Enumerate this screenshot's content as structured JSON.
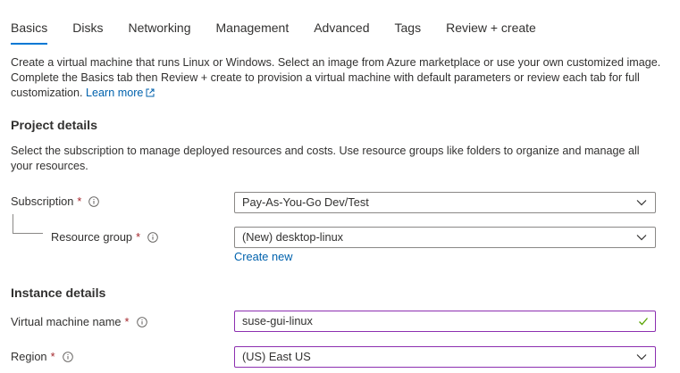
{
  "tabs": [
    {
      "label": "Basics",
      "active": true
    },
    {
      "label": "Disks"
    },
    {
      "label": "Networking"
    },
    {
      "label": "Management"
    },
    {
      "label": "Advanced"
    },
    {
      "label": "Tags"
    },
    {
      "label": "Review + create"
    }
  ],
  "intro": {
    "text": "Create a virtual machine that runs Linux or Windows. Select an image from Azure marketplace or use your own customized image. Complete the Basics tab then Review + create to provision a virtual machine with default parameters or review each tab for full customization.",
    "learn_more": "Learn more",
    "learn_more_icon": "external-link-icon"
  },
  "project_details": {
    "heading": "Project details",
    "description": "Select the subscription to manage deployed resources and costs. Use resource groups like folders to organize and manage all your resources.",
    "subscription": {
      "label": "Subscription",
      "required": "*",
      "value": "Pay-As-You-Go Dev/Test"
    },
    "resource_group": {
      "label": "Resource group",
      "required": "*",
      "value": "(New) desktop-linux",
      "create_new": "Create new"
    }
  },
  "instance_details": {
    "heading": "Instance details",
    "vm_name": {
      "label": "Virtual machine name",
      "required": "*",
      "value": "suse-gui-linux"
    },
    "region": {
      "label": "Region",
      "required": "*",
      "value": "(US) East US"
    }
  },
  "colors": {
    "accent": "#0078d4",
    "link": "#0062ad",
    "required": "#a4262c",
    "focus_border": "#8c2fb0",
    "valid": "#57a300"
  }
}
